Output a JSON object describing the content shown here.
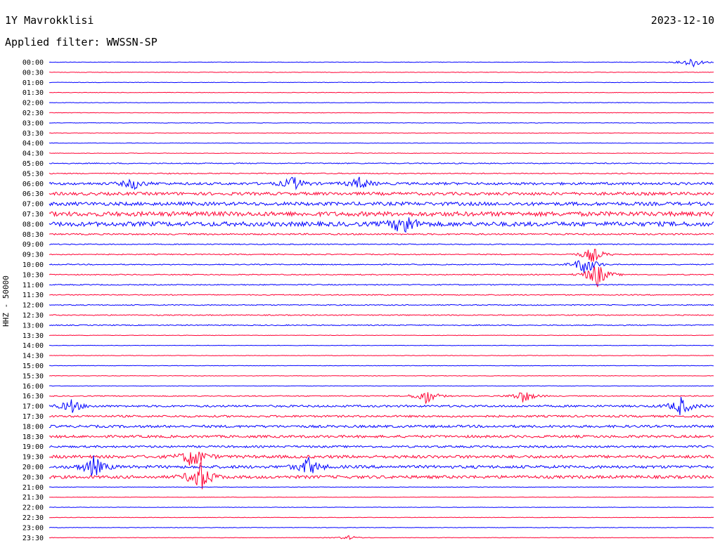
{
  "header": {
    "station": "1Y Mavrokklisi",
    "date": "2023-12-10",
    "filter_prefix": "Applied filter:",
    "filter_name": "WWSSN-SP"
  },
  "y_axis_label": "HHZ - 50000",
  "colors": {
    "even_row": "#0000ff",
    "odd_row": "#ff0033"
  },
  "chart_data": {
    "type": "line",
    "title": "1Y Mavrokklisi",
    "subtitle": "Applied filter: WWSSN-SP",
    "ylabel": "HHZ - 50000",
    "grid": false,
    "legend": "none",
    "row_interval_minutes": 30,
    "tick_labels": [
      "00:00",
      "00:30",
      "01:00",
      "01:30",
      "02:00",
      "02:30",
      "03:00",
      "03:30",
      "04:00",
      "04:30",
      "05:00",
      "05:30",
      "06:00",
      "06:30",
      "07:00",
      "07:30",
      "08:00",
      "08:30",
      "09:00",
      "09:30",
      "10:00",
      "10:30",
      "11:00",
      "11:30",
      "12:00",
      "12:30",
      "13:00",
      "13:30",
      "14:00",
      "14:30",
      "15:00",
      "15:30",
      "16:00",
      "16:30",
      "17:00",
      "17:30",
      "18:00",
      "18:30",
      "19:00",
      "19:30",
      "20:00",
      "20:30",
      "21:00",
      "21:30",
      "22:00",
      "22:30",
      "23:00",
      "23:30"
    ],
    "relative_noise_level": [
      1,
      1,
      1,
      1,
      1,
      1,
      1,
      1,
      1,
      1,
      2,
      2,
      5,
      6,
      7,
      9,
      9,
      3,
      2,
      2,
      2,
      2,
      2,
      2,
      2,
      2,
      2,
      1,
      1,
      1,
      1,
      1,
      1,
      2,
      4,
      4,
      5,
      5,
      4,
      6,
      6,
      6,
      1,
      1,
      1,
      1,
      1,
      1
    ],
    "events": [
      {
        "row": 0,
        "minute": 29.0,
        "amplitude": 8
      },
      {
        "row": 12,
        "minute": 3.8,
        "amplitude": 8
      },
      {
        "row": 12,
        "minute": 11.0,
        "amplitude": 10
      },
      {
        "row": 12,
        "minute": 14.0,
        "amplitude": 9
      },
      {
        "row": 16,
        "minute": 16.0,
        "amplitude": 18
      },
      {
        "row": 19,
        "minute": 24.5,
        "amplitude": 12
      },
      {
        "row": 20,
        "minute": 24.2,
        "amplitude": 16
      },
      {
        "row": 21,
        "minute": 24.7,
        "amplitude": 20
      },
      {
        "row": 33,
        "minute": 17.0,
        "amplitude": 12
      },
      {
        "row": 33,
        "minute": 21.4,
        "amplitude": 10
      },
      {
        "row": 34,
        "minute": 1.0,
        "amplitude": 10
      },
      {
        "row": 34,
        "minute": 28.5,
        "amplitude": 14
      },
      {
        "row": 39,
        "minute": 6.5,
        "amplitude": 18
      },
      {
        "row": 40,
        "minute": 2.0,
        "amplitude": 16
      },
      {
        "row": 40,
        "minute": 11.7,
        "amplitude": 14
      },
      {
        "row": 41,
        "minute": 6.8,
        "amplitude": 24
      },
      {
        "row": 47,
        "minute": 13.5,
        "amplitude": 3
      }
    ]
  }
}
